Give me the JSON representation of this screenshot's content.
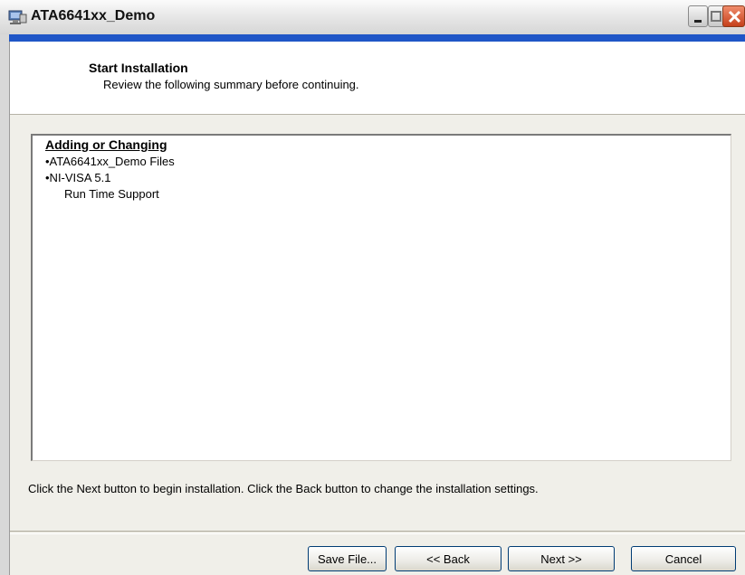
{
  "window": {
    "title": "ATA6641xx_Demo"
  },
  "header": {
    "title": "Start Installation",
    "subtitle": "Review the following summary before continuing."
  },
  "summary": {
    "heading": "Adding or Changing",
    "items": [
      "•ATA6641xx_Demo Files",
      "•NI-VISA 5.1"
    ],
    "subitems": [
      "Run Time Support"
    ]
  },
  "instruction": "Click the Next button to begin installation.  Click the Back button to change the installation settings.",
  "buttons": {
    "save": "Save File...",
    "back": "<< Back",
    "next": "Next >>",
    "cancel": "Cancel"
  },
  "colors": {
    "accent_strip": "#1f56c7",
    "close_button": "#c5401b"
  },
  "icons": {
    "app": "installer-icon",
    "minimize": "minimize-icon",
    "maximize": "maximize-icon",
    "close": "close-icon"
  }
}
